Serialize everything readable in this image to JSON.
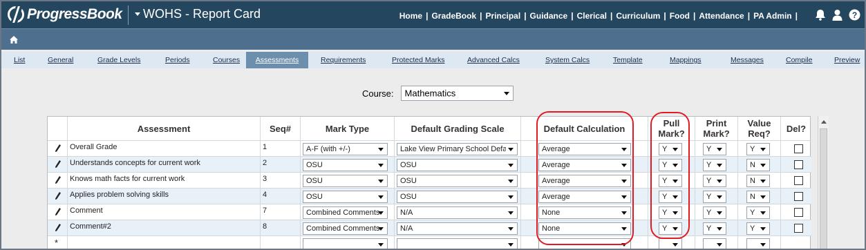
{
  "app": {
    "brand": "ProgressBook",
    "title": "WOHS - Report Card"
  },
  "topnav": [
    "Home",
    "GradeBook",
    "Principal",
    "Guidance",
    "Clerical",
    "Curriculum",
    "Food",
    "Attendance",
    "PA Admin"
  ],
  "top_icons": [
    "bell-icon",
    "user-icon",
    "help-icon"
  ],
  "tabs": [
    {
      "label": "List"
    },
    {
      "label": "General"
    },
    {
      "label": "Grade Levels"
    },
    {
      "label": "Periods"
    },
    {
      "label": "Courses"
    },
    {
      "label": "Assessments",
      "active": true
    },
    {
      "label": "Requirements"
    },
    {
      "label": "Protected Marks"
    },
    {
      "label": "Advanced Calcs"
    },
    {
      "label": "System Calcs"
    },
    {
      "label": "Template"
    },
    {
      "label": "Mappings"
    },
    {
      "label": "Messages"
    },
    {
      "label": "Compile"
    },
    {
      "label": "Preview"
    }
  ],
  "course": {
    "label": "Course:",
    "value": "Mathematics"
  },
  "grid": {
    "headers": {
      "assessment": "Assessment",
      "seq": "Seq#",
      "mark_type": "Mark Type",
      "scale": "Default Grading Scale",
      "calc": "Default Calculation",
      "pull": "Pull Mark?",
      "print": "Print Mark?",
      "value_req": "Value Req?",
      "del": "Del?"
    },
    "rows": [
      {
        "assessment": "Overall Grade",
        "seq": "1",
        "mark_type": "A-F (with +/-)",
        "scale": "Lake View Primary School Defa",
        "calc": "Average",
        "pull": "Y",
        "print": "Y",
        "value_req": "Y"
      },
      {
        "assessment": "Understands concepts for current work",
        "seq": "2",
        "mark_type": "OSU",
        "scale": "OSU",
        "calc": "Average",
        "pull": "Y",
        "print": "Y",
        "value_req": "N"
      },
      {
        "assessment": "Knows math facts for current work",
        "seq": "3",
        "mark_type": "OSU",
        "scale": "OSU",
        "calc": "Average",
        "pull": "Y",
        "print": "Y",
        "value_req": "N"
      },
      {
        "assessment": "Applies problem solving skills",
        "seq": "4",
        "mark_type": "OSU",
        "scale": "OSU",
        "calc": "Average",
        "pull": "Y",
        "print": "Y",
        "value_req": "N"
      },
      {
        "assessment": "Comment",
        "seq": "7",
        "mark_type": "Combined Comments",
        "scale": "N/A",
        "calc": "None",
        "pull": "Y",
        "print": "Y",
        "value_req": "Y"
      },
      {
        "assessment": "Comment#2",
        "seq": "8",
        "mark_type": "Combined Comments",
        "scale": "N/A",
        "calc": "None",
        "pull": "Y",
        "print": "Y",
        "value_req": "Y"
      }
    ],
    "new_row_symbol": "*"
  },
  "colors": {
    "header_bg": "#24465f",
    "subbar_bg": "#4e6f8d",
    "tab_active_bg": "#6c8fae",
    "highlight_ring": "#e11b22"
  }
}
